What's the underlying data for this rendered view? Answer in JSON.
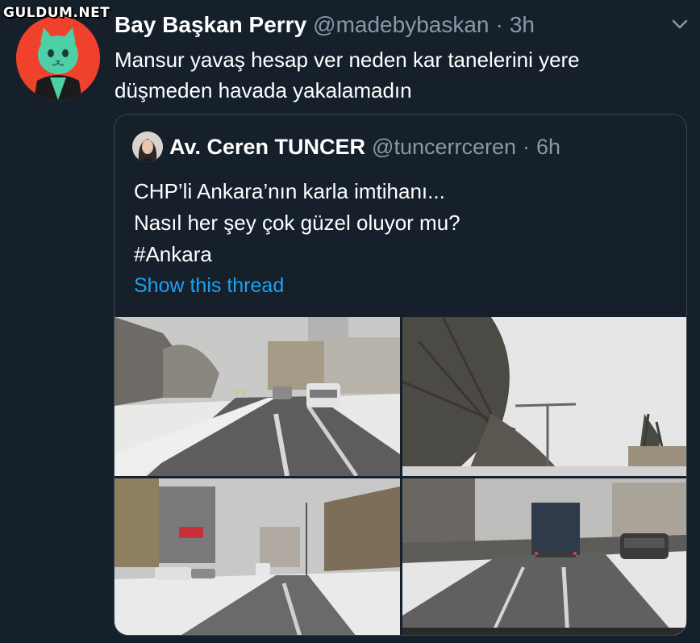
{
  "watermark": "GULDUM.NET",
  "tweet": {
    "author_name": "Bay Başkan Perry",
    "author_handle": "@madebybaskan",
    "separator": "·",
    "time": "3h",
    "text": "Mansur yavaş hesap ver neden kar tanelerini yere düşmeden havada yakalamadın",
    "avatar_icon": "green-cat-avatar-icon",
    "menu_icon": "chevron-down-icon"
  },
  "quoted": {
    "author_name": "Av. Ceren TUNCER",
    "author_handle": "@tuncerrceren",
    "separator": "·",
    "time": "6h",
    "lines": [
      "CHP’li Ankara’nın karla imtihanı...",
      "Nasıl her şey çok güzel oluyor mu?",
      "#Ankara"
    ],
    "show_thread": "Show this thread",
    "photos": [
      "snowy-road-traffic",
      "snowy-trees-streetlight",
      "snowy-street-buildings",
      "snowy-road-truck"
    ]
  },
  "colors": {
    "background": "#15202b",
    "secondary_text": "#8899a6",
    "link": "#1da1f2",
    "border": "#38444d",
    "avatar_bg": "#f0412c",
    "avatar_cat": "#4dd0a8"
  }
}
